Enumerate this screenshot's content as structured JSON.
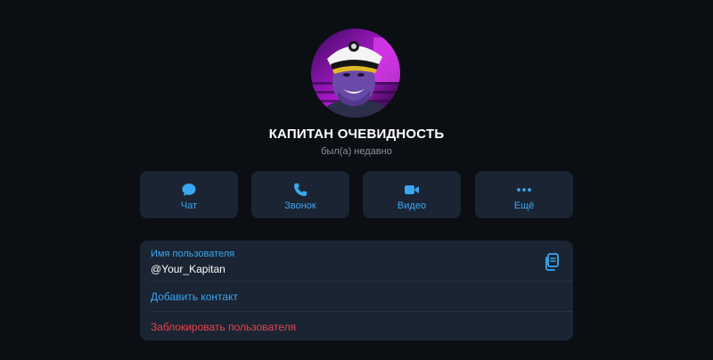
{
  "profile": {
    "name": "КАПИТАН ОЧЕВИДНОСТЬ",
    "status": "был(а) недавно"
  },
  "actions": [
    {
      "label": "Чат",
      "icon": "chat-bubble-icon"
    },
    {
      "label": "Звонок",
      "icon": "phone-icon"
    },
    {
      "label": "Видео",
      "icon": "video-camera-icon"
    },
    {
      "label": "Ещё",
      "icon": "more-dots-icon"
    }
  ],
  "info": {
    "username_label": "Имя пользователя",
    "username_value": "@Your_Kapitan",
    "add_contact": "Добавить контакт",
    "block_user": "Заблокировать пользователя",
    "copy_icon": "copy-icon"
  },
  "colors": {
    "background": "#0b0e13",
    "panel": "#1a2433",
    "accent": "#3aa7f0",
    "danger": "#e5454f",
    "text": "#ffffff",
    "muted": "#8a93a0"
  }
}
